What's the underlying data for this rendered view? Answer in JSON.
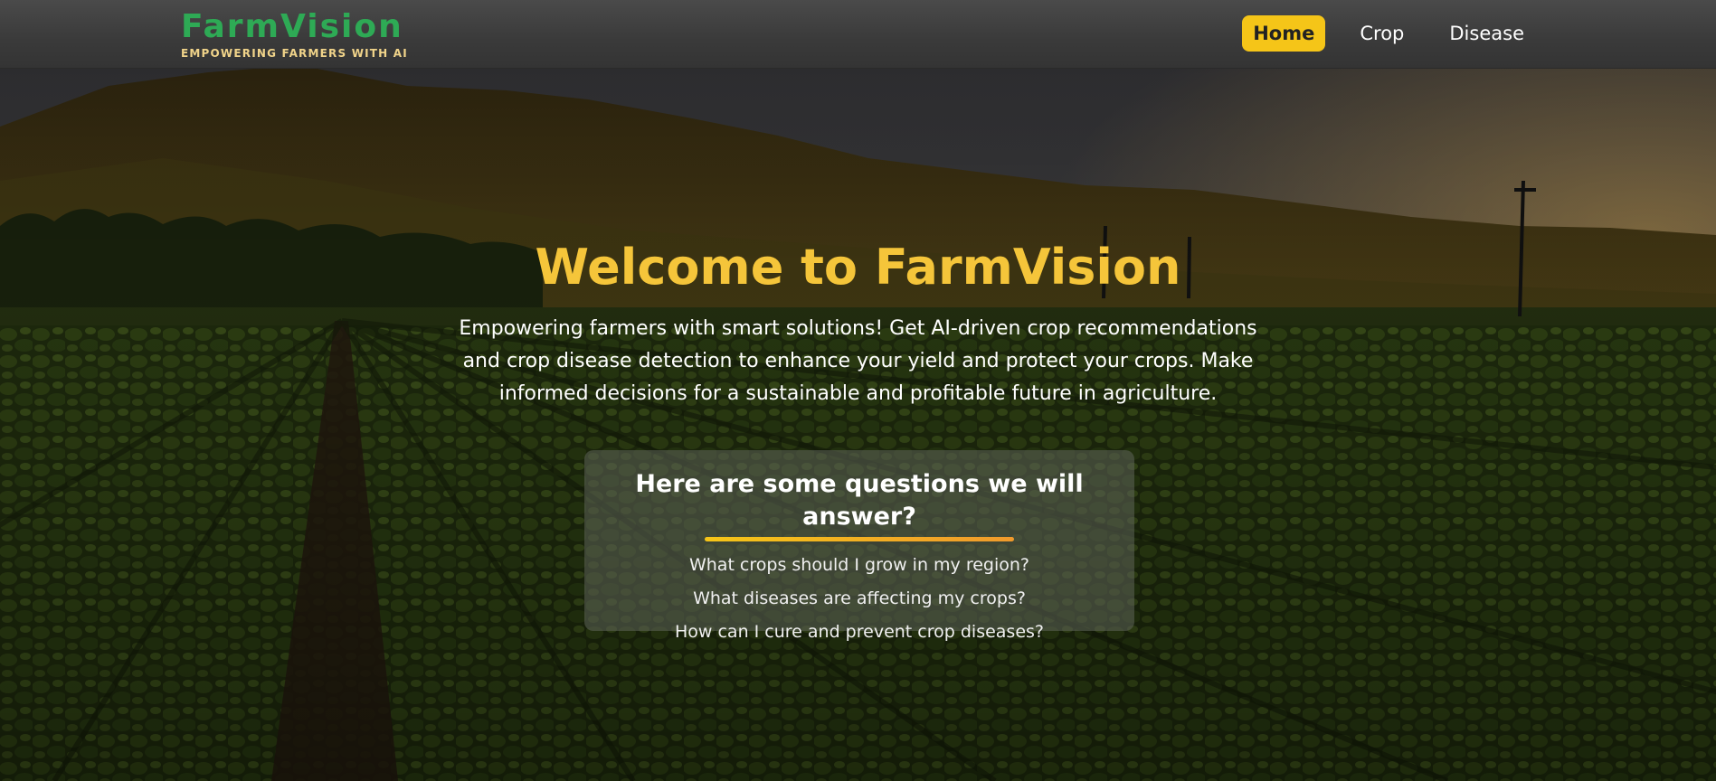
{
  "brand": {
    "name": "FarmVision",
    "tagline": "EMPOWERING FARMERS WITH AI"
  },
  "nav": {
    "items": [
      {
        "label": "Home",
        "active": true
      },
      {
        "label": "Crop",
        "active": false
      },
      {
        "label": "Disease",
        "active": false
      }
    ]
  },
  "hero": {
    "title": "Welcome to FarmVision",
    "description": "Empowering farmers with smart solutions! Get AI-driven crop recommendations and crop disease detection to enhance your yield and protect your crops. Make informed decisions for a sustainable and profitable future in agriculture."
  },
  "questions": {
    "title": "Here are some questions we will answer?",
    "items": [
      "What crops should I grow in my region?",
      "What diseases are affecting my crops?",
      "How can I cure and prevent crop diseases?"
    ]
  },
  "colors": {
    "brand_green": "#2eaa55",
    "tagline_gold": "#f1d48a",
    "accent_yellow": "#f5c518",
    "title_gold": "#f5c53a",
    "underline_orange": "#f09a2c"
  }
}
